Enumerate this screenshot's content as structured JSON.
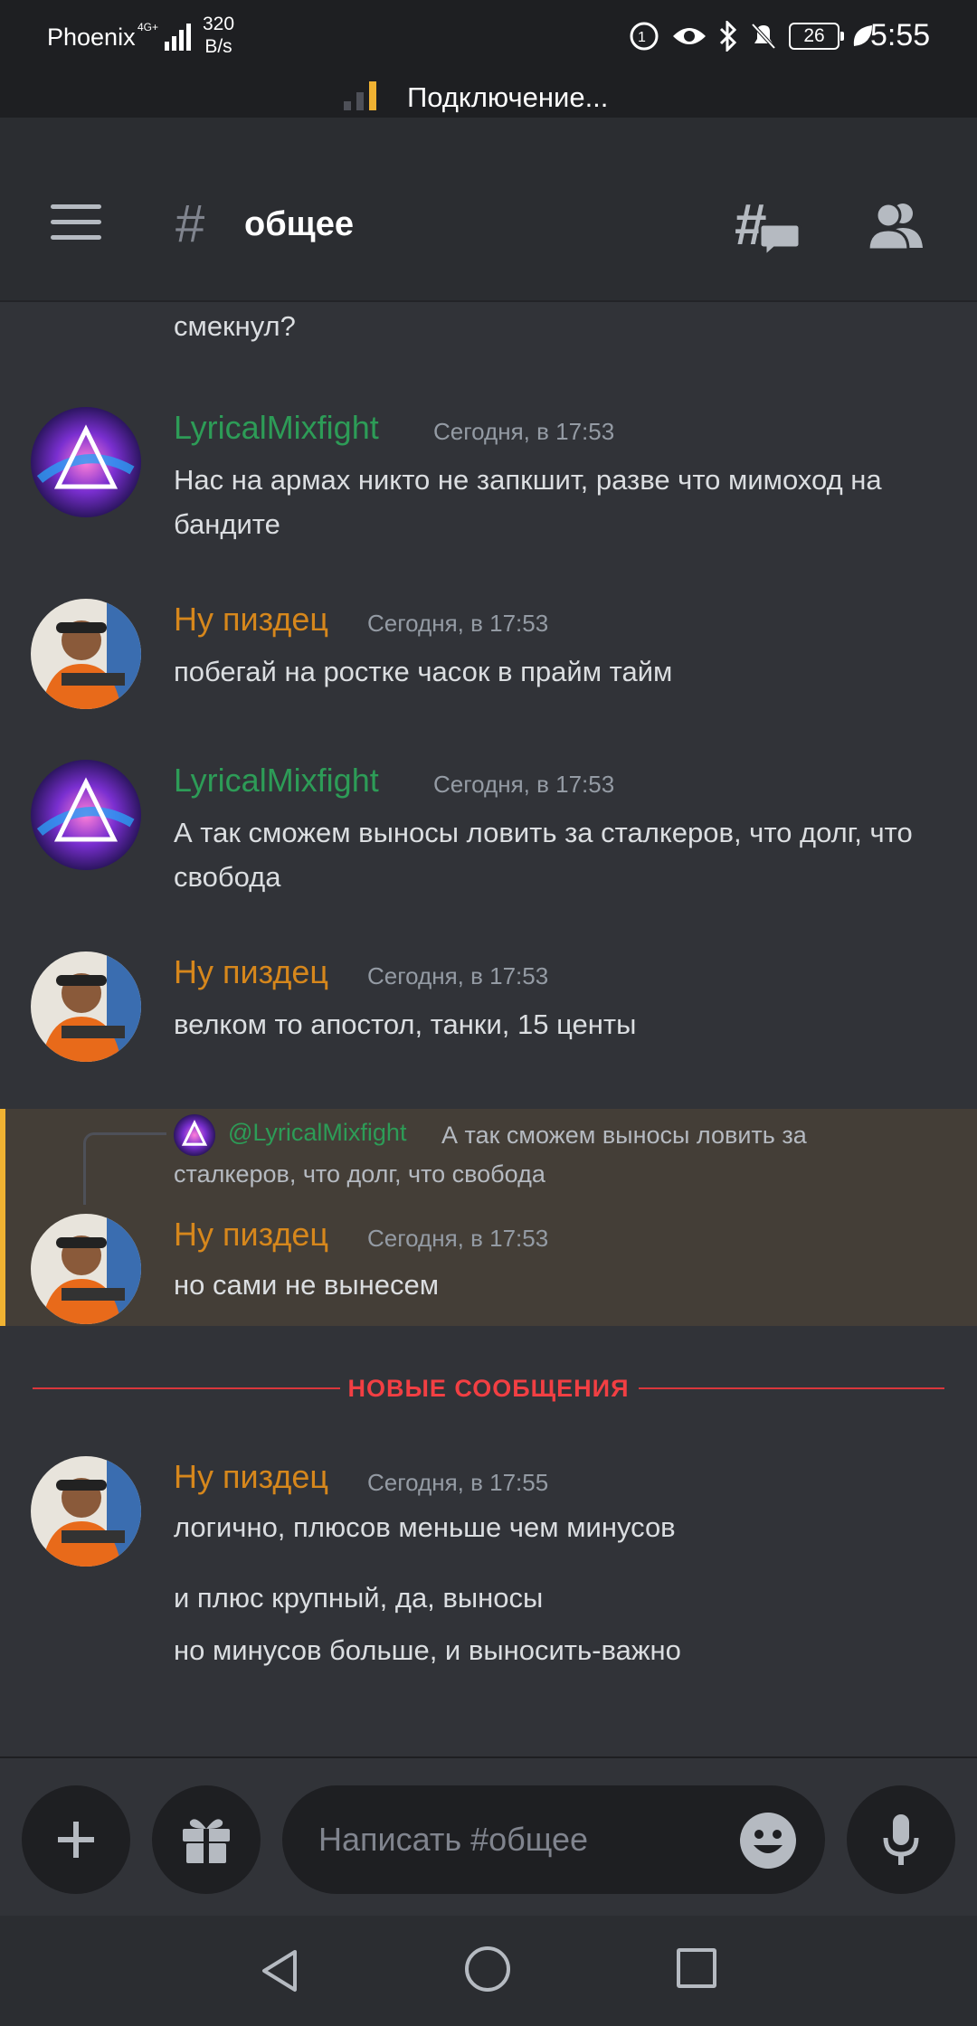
{
  "status_bar": {
    "carrier": "Phoenix",
    "network": "4G+",
    "speed_value": "320",
    "speed_unit": "B/s",
    "battery": "26",
    "time": "5:55"
  },
  "connection": {
    "text": "Подключение..."
  },
  "header": {
    "hash": "#",
    "channel": "общее"
  },
  "messages": {
    "top_fragment": "смекнул?",
    "m1": {
      "user": "LyricalMixfight",
      "time": "Сегодня, в 17:53",
      "text": "Нас на армах никто не запкшит, разве что мимоход на бандите"
    },
    "m2": {
      "user": "Ну пиздец",
      "time": "Сегодня, в 17:53",
      "text": "побегай на ростке часок в прайм тайм"
    },
    "m3": {
      "user": "LyricalMixfight",
      "time": "Сегодня, в 17:53",
      "text": "А так сможем выносы ловить за сталкеров, что долг, что свобода"
    },
    "m4": {
      "user": "Ну пиздец",
      "time": "Сегодня, в 17:53",
      "text": "велком то апостол, танки, 15 центы"
    },
    "m5": {
      "reply_user": "@LyricalMixfight",
      "reply_text": "А так сможем выносы ловить за сталкеров, что долг, что свобода",
      "user": "Ну пиздец",
      "time": "Сегодня, в 17:53",
      "text": "но сами не вынесем"
    },
    "new_divider": "НОВЫЕ СООБЩЕНИЯ",
    "m6": {
      "user": "Ну пиздец",
      "time": "Сегодня, в 17:55",
      "lines": [
        "логично, плюсов меньше чем минусов",
        "и плюс крупный, да, выносы",
        "но минусов больше, и выносить-важно"
      ]
    }
  },
  "composer": {
    "placeholder": "Написать #общее"
  },
  "colors": {
    "bg": "#313338",
    "green_user": "#2d9c57",
    "orange_user": "#d6871c",
    "new_divider": "#f23f43",
    "highlight": "#443e37",
    "highlight_border": "#f0b232"
  },
  "icons": [
    "signal-icon",
    "hamburger-icon",
    "threads-icon",
    "members-icon",
    "plus-icon",
    "gift-icon",
    "emoji-icon",
    "mic-icon",
    "back-icon",
    "home-icon",
    "recent-icon"
  ]
}
